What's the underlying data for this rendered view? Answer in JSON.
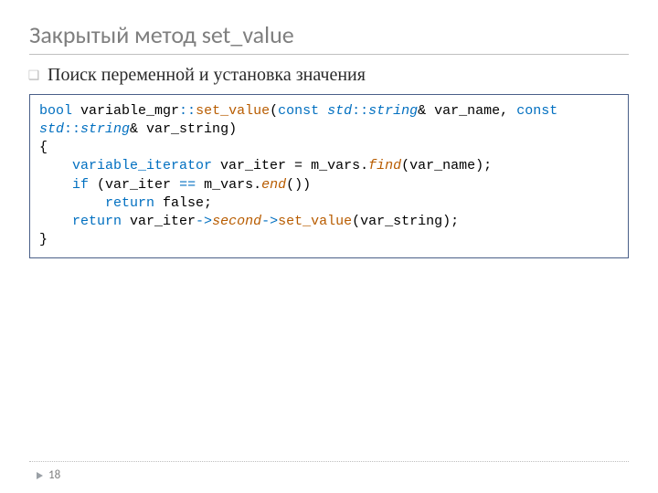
{
  "slide": {
    "title": "Закрытый метод set_value",
    "bullet": "Поиск переменной и установка значения",
    "page_number": "18"
  },
  "code": {
    "l1_bool": "bool",
    "l1_cls": " variable_mgr",
    "l1_dcol1": "::",
    "l1_fn": "set_value",
    "l1_paren_const": "(",
    "l1_const1": "const",
    "l1_sp1": " ",
    "l1_std1": "std",
    "l1_dcol2": "::",
    "l1_string1": "string",
    "l1_amp1": "& var_name, ",
    "l1_const2": "const",
    "l2_std": "std",
    "l2_dcol": "::",
    "l2_string": "string",
    "l2_rest": "& var_string)",
    "l3": "{",
    "l4_indent": "    ",
    "l4_type": "variable_iterator",
    "l4_mid": " var_iter = m_vars.",
    "l4_find": "find",
    "l4_end": "(var_name);",
    "l5_indent": "    ",
    "l5_if": "if",
    "l5_open": " (var_iter ",
    "l5_eq": "==",
    "l5_mvars": " m_vars.",
    "l5_end": "end",
    "l5_close": "())",
    "l6_indent": "        ",
    "l6_return": "return",
    "l6_false": " false;",
    "l7_indent": "    ",
    "l7_return": "return",
    "l7_var": " var_iter",
    "l7_arrow1": "->",
    "l7_second": "second",
    "l7_arrow2": "->",
    "l7_setv": "set_value",
    "l7_tail": "(var_string);",
    "l8": "}"
  }
}
